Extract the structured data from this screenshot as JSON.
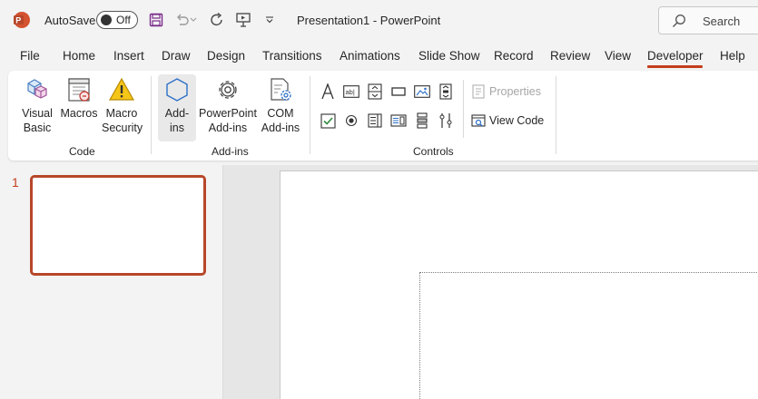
{
  "titlebar": {
    "app_icon": "powerpoint-logo",
    "autosave_label": "AutoSave",
    "autosave_state": "Off",
    "document_title": "Presentation1  -  PowerPoint",
    "search_placeholder": "Search",
    "quick_access": [
      "save-icon",
      "undo-icon",
      "redo-icon",
      "present-from-beginning-icon",
      "customize-qat-icon"
    ]
  },
  "tabs": [
    "File",
    "Home",
    "Insert",
    "Draw",
    "Design",
    "Transitions",
    "Animations",
    "Slide Show",
    "Record",
    "Review",
    "View",
    "Developer",
    "Help"
  ],
  "active_tab": "Developer",
  "ribbon": {
    "code": {
      "label": "Code",
      "visual_basic": [
        "Visual",
        "Basic"
      ],
      "macros": [
        "Macros"
      ],
      "macro_security": [
        "Macro",
        "Security"
      ]
    },
    "addins": {
      "label": "Add-ins",
      "addins": [
        "Add-",
        "ins"
      ],
      "powerpoint_addins": [
        "PowerPoint",
        "Add-ins"
      ],
      "com_addins": [
        "COM",
        "Add-ins"
      ]
    },
    "controls": {
      "label": "Controls",
      "properties": "Properties",
      "view_code": "View Code",
      "row1": [
        "label-control-icon",
        "textbox-control-icon",
        "spin-button-control-icon",
        "command-button-control-icon",
        "image-control-icon",
        "scrollbar-control-icon"
      ],
      "row2": [
        "checkbox-control-icon",
        "option-button-control-icon",
        "listbox-control-icon",
        "combobox-control-icon",
        "toggle-button-control-icon",
        "more-controls-icon"
      ]
    }
  },
  "slides": [
    {
      "number": "1"
    }
  ],
  "colors": {
    "accent": "#c43e1c",
    "thumb_border": "#b7472a",
    "background": "#f3f3f3"
  }
}
